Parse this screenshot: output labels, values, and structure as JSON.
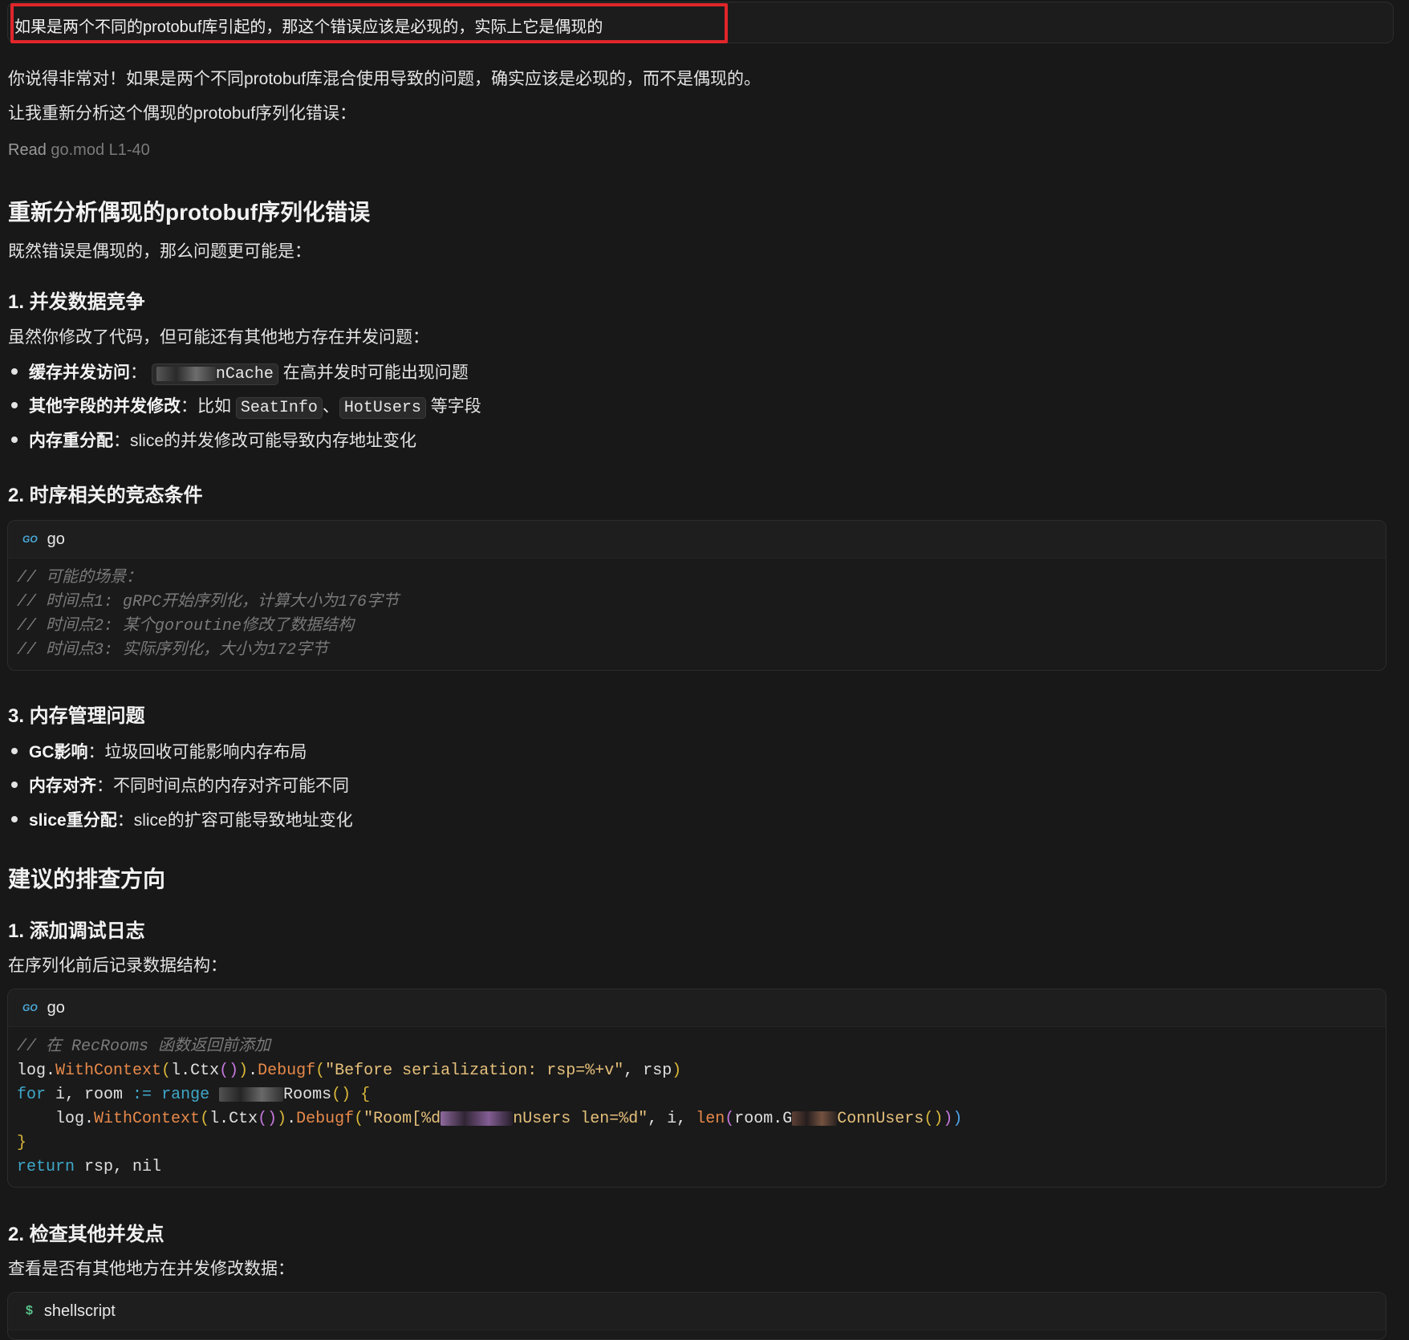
{
  "user_message": {
    "text": "如果是两个不同的protobuf库引起的，那这个错误应该是必现的，实际上它是偶现的"
  },
  "response": {
    "p1": "你说得非常对！如果是两个不同protobuf库混合使用导致的问题，确实应该是必现的，而不是偶现的。",
    "p2": "让我重新分析这个偶现的protobuf序列化错误：",
    "tool_read": {
      "action": "Read",
      "target": "go.mod L1-40"
    },
    "h_main": "重新分析偶现的protobuf序列化错误",
    "p3": "既然错误是偶现的，那么问题更可能是：",
    "sec1": {
      "title": "1. 并发数据竞争",
      "intro": "虽然你修改了代码，但可能还有其他地方存在并发问题：",
      "items": [
        {
          "bold": "缓存并发访问",
          "sep": "：",
          "code1_tail": "nCache",
          "rest": " 在高并发时可能出现问题"
        },
        {
          "bold": "其他字段的并发修改",
          "sep": "：",
          "pre": "比如 ",
          "code1": "SeatInfo",
          "mid": "、",
          "code2": "HotUsers",
          "rest": " 等字段"
        },
        {
          "bold": "内存重分配",
          "sep": "：",
          "rest": "slice的并发修改可能导致内存地址变化"
        }
      ]
    },
    "sec2": {
      "title": "2. 时序相关的竞态条件",
      "code_lang": "go",
      "code_lines": [
        "// 可能的场景：",
        "// 时间点1: gRPC开始序列化，计算大小为176字节",
        "// 时间点2: 某个goroutine修改了数据结构",
        "// 时间点3: 实际序列化，大小为172字节"
      ]
    },
    "sec3": {
      "title": "3. 内存管理问题",
      "items": [
        {
          "bold": "GC影响",
          "sep": "：",
          "rest": "垃圾回收可能影响内存布局"
        },
        {
          "bold": "内存对齐",
          "sep": "：",
          "rest": "不同时间点的内存对齐可能不同"
        },
        {
          "bold": "slice重分配",
          "sep": "：",
          "rest": "slice的扩容可能导致地址变化"
        }
      ]
    },
    "h_suggest": "建议的排查方向",
    "sug1": {
      "title": "1. 添加调试日志",
      "intro": "在序列化前后记录数据结构：",
      "code_lang": "go",
      "comment": "// 在 RecRooms 函数返回前添加",
      "log_prefix": "log.",
      "with_context": "WithContext",
      "l_ctx": "l.Ctx",
      "debugf": "Debugf",
      "before_str": "\"Before serialization: rsp=%+v\"",
      "rsp_arg": ", rsp",
      "for_kw": "for",
      "loop_vars": " i, room ",
      "assign": ":=",
      "range_kw": " range ",
      "rooms_tail": "Rooms",
      "call_suffix": "() ",
      "brace_open": "{",
      "room_str_head": "\"Room[%d",
      "room_str_tail": "nUsers len=%d\"",
      "i_arg": ", i, ",
      "len_fn": "len",
      "room_g": "room.G",
      "conn_users": "ConnUsers",
      "brace_close": "}",
      "return_kw": "return",
      "return_vals": " rsp, nil"
    },
    "sug2": {
      "title": "2. 检查其他并发点",
      "intro": "查看是否有其他地方在并发修改数据：",
      "code_lang": "shellscript",
      "code_icon": "$"
    }
  }
}
